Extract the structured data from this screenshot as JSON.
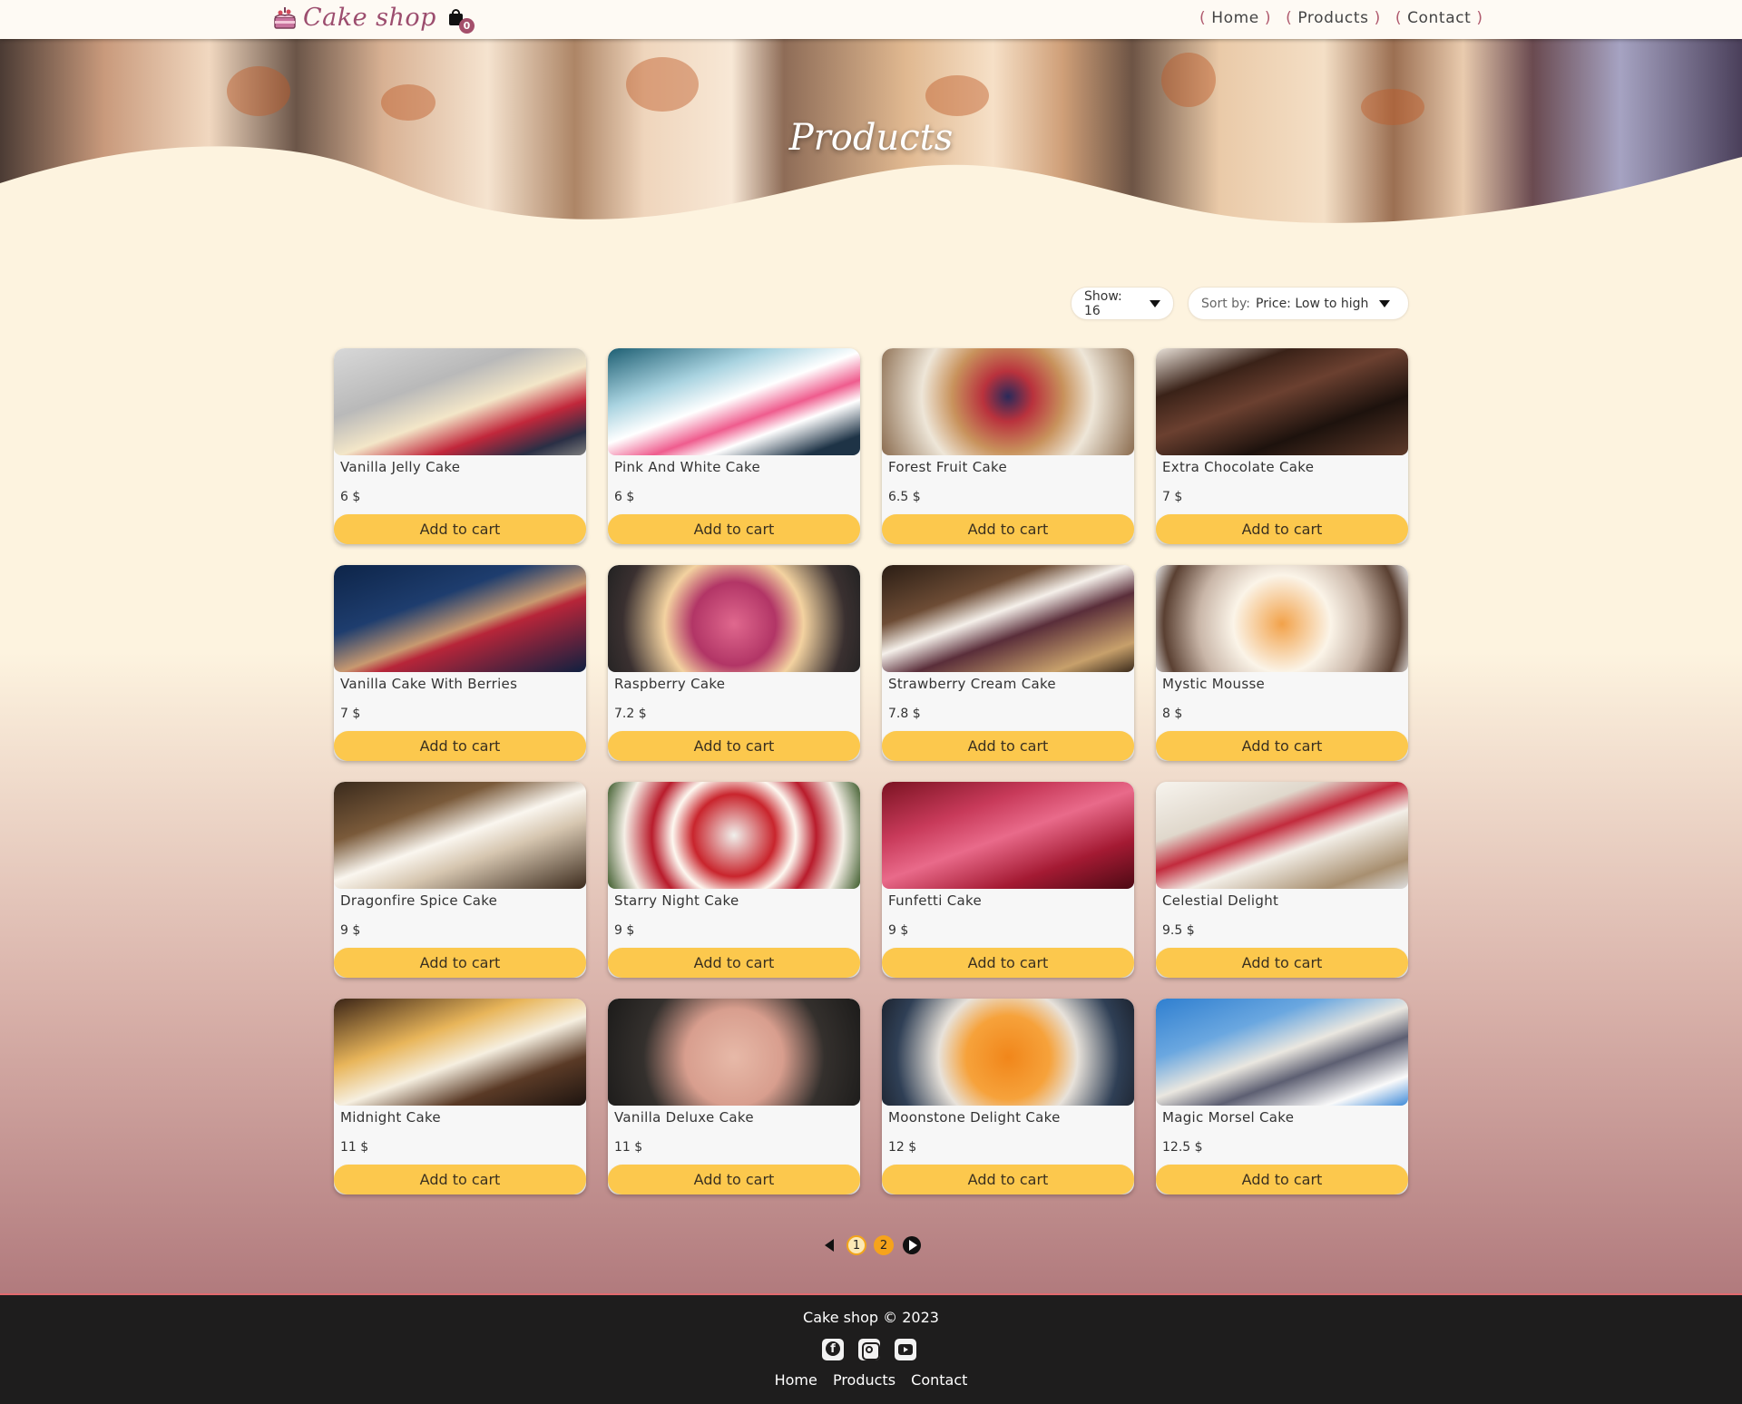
{
  "navbar": {
    "brand": "Cake shop",
    "cart_count": "0",
    "links": [
      "Home",
      "Products",
      "Contact"
    ]
  },
  "hero": {
    "title": "Products"
  },
  "controls": {
    "show_label": "Show: 16",
    "sort_prefix": "Sort by:",
    "sort_value": "Price: Low to high"
  },
  "products": [
    {
      "name": "Vanilla Jelly Cake",
      "price": "6 $",
      "button": "Add to cart"
    },
    {
      "name": "Pink And White Cake",
      "price": "6 $",
      "button": "Add to cart"
    },
    {
      "name": "Forest Fruit Cake",
      "price": "6.5 $",
      "button": "Add to cart"
    },
    {
      "name": "Extra Chocolate Cake",
      "price": "7 $",
      "button": "Add to cart"
    },
    {
      "name": "Vanilla Cake With Berries",
      "price": "7 $",
      "button": "Add to cart"
    },
    {
      "name": "Raspberry Cake",
      "price": "7.2 $",
      "button": "Add to cart"
    },
    {
      "name": "Strawberry Cream Cake",
      "price": "7.8 $",
      "button": "Add to cart"
    },
    {
      "name": "Mystic Mousse",
      "price": "8 $",
      "button": "Add to cart"
    },
    {
      "name": "Dragonfire Spice Cake",
      "price": "9 $",
      "button": "Add to cart"
    },
    {
      "name": "Starry Night Cake",
      "price": "9 $",
      "button": "Add to cart"
    },
    {
      "name": "Funfetti Cake",
      "price": "9 $",
      "button": "Add to cart"
    },
    {
      "name": "Celestial Delight",
      "price": "9.5 $",
      "button": "Add to cart"
    },
    {
      "name": "Midnight Cake",
      "price": "11 $",
      "button": "Add to cart"
    },
    {
      "name": "Vanilla Deluxe Cake",
      "price": "11 $",
      "button": "Add to cart"
    },
    {
      "name": "Moonstone Delight Cake",
      "price": "12 $",
      "button": "Add to cart"
    },
    {
      "name": "Magic Morsel Cake",
      "price": "12.5 $",
      "button": "Add to cart"
    }
  ],
  "pagination": {
    "pages": [
      "1",
      "2"
    ],
    "current": "1"
  },
  "footer": {
    "copyright": "Cake shop © 2023",
    "socials": [
      "facebook-icon",
      "instagram-icon",
      "youtube-icon"
    ],
    "links": [
      "Home",
      "Products",
      "Contact"
    ]
  },
  "colors": {
    "brand": "#9c4d6e",
    "button": "#fcc84d",
    "page_active": "#f6a31b",
    "footer_bg": "#1e1d1d",
    "footer_border": "#e26a6e"
  }
}
